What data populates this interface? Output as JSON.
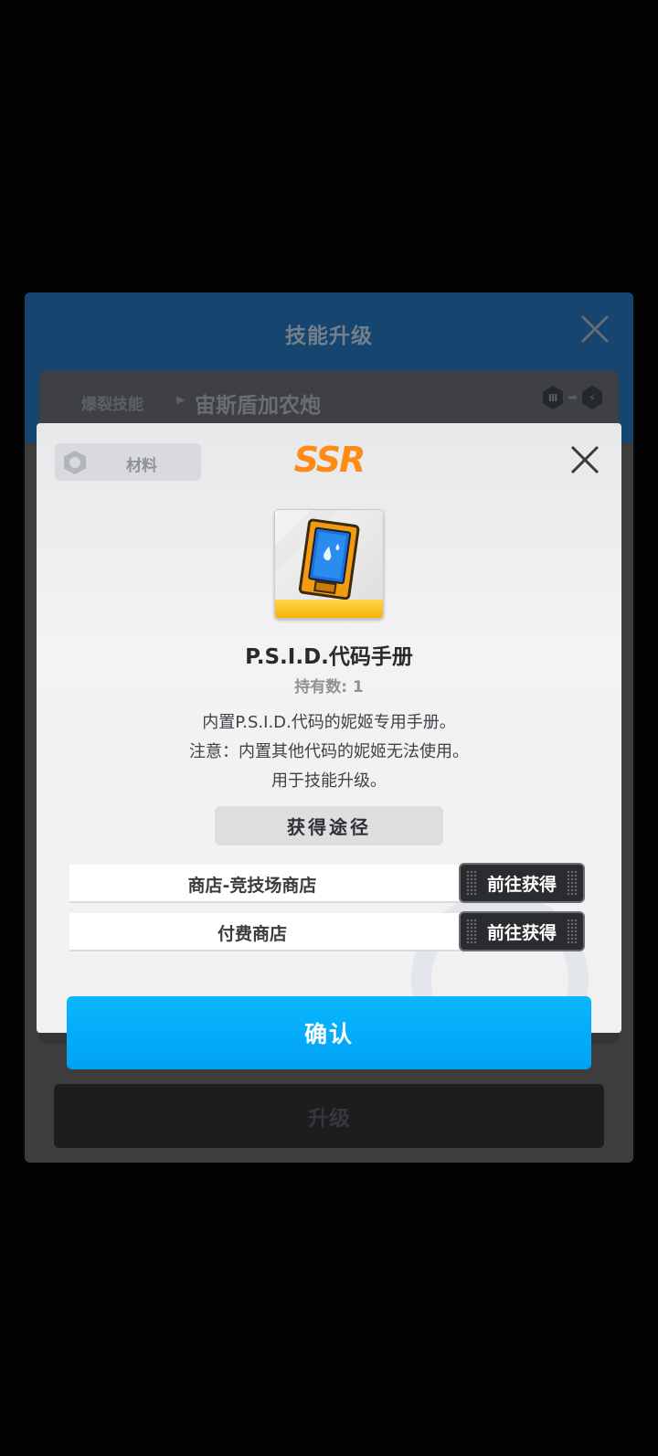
{
  "background_dialog": {
    "title": "技能升级",
    "skill_type": "爆裂技能",
    "skill_name": "宙斯盾加农炮",
    "level_from": "Ⅲ",
    "upgrade_label": "升级"
  },
  "item_dialog": {
    "category": "材料",
    "rarity": "SSR",
    "name": "P.S.I.D.代码手册",
    "owned_label": "持有数: 1",
    "description_lines": [
      "内置P.S.I.D.代码的妮姬专用手册。",
      "注意：内置其他代码的妮姬无法使用。",
      "用于技能升级。"
    ],
    "sources_header": "获得途径",
    "sources": [
      {
        "name": "商店-竞技场商店",
        "action": "前往获得"
      },
      {
        "name": "付费商店",
        "action": "前往获得"
      }
    ],
    "confirm_label": "确认"
  },
  "colors": {
    "rarity": "#ff8a14",
    "confirm": "#00a3f3",
    "item_rarity_strip": "#f6b400"
  },
  "icons": {
    "close": "close-icon",
    "category": "hexagon-gear-icon",
    "item": "manual-water-drop-icon",
    "level_to": "lightning-icon"
  }
}
